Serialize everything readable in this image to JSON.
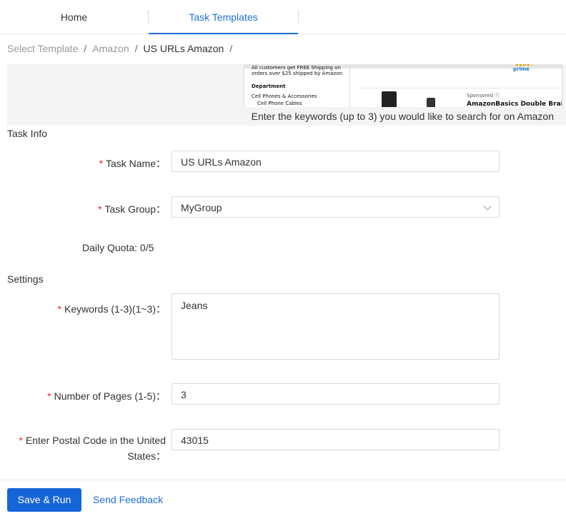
{
  "tabs": {
    "home": "Home",
    "templates": "Task Templates"
  },
  "breadcrumb": {
    "items": [
      "Select Template",
      "Amazon",
      "US URLs Amazon"
    ],
    "sep": "/"
  },
  "preview": {
    "line1": "All customers get FREE Shipping on",
    "line2": "orders over $25 shipped by Amazon",
    "dept": "Department",
    "cat1": "Cell Phones & Accessories",
    "cat2": "Cell Phone Cables",
    "prime": "prime",
    "stars": "★★★★☆",
    "sponsored": "Sponsored ⓘ",
    "product": "AmazonBasics Double Braided",
    "caption": "Enter the keywords (up to 3) you would like to search for on Amazon"
  },
  "task_info": {
    "title": "Task Info",
    "name_label": "Task Name",
    "name_value": "US URLs Amazon",
    "group_label": "Task Group",
    "group_value": "MyGroup",
    "quota": "Daily Quota: 0/5"
  },
  "settings": {
    "title": "Settings",
    "keywords_label": "Keywords (1-3)(1~3)",
    "keywords_value": "Jeans",
    "pages_label": "Number of Pages (1-5)",
    "pages_value": "3",
    "postal_label_1": "Enter Postal Code in the United",
    "postal_label_2": "States",
    "postal_value": "43015",
    "colon": "："
  },
  "footer": {
    "save_run": "Save & Run",
    "feedback": "Send Feedback"
  }
}
